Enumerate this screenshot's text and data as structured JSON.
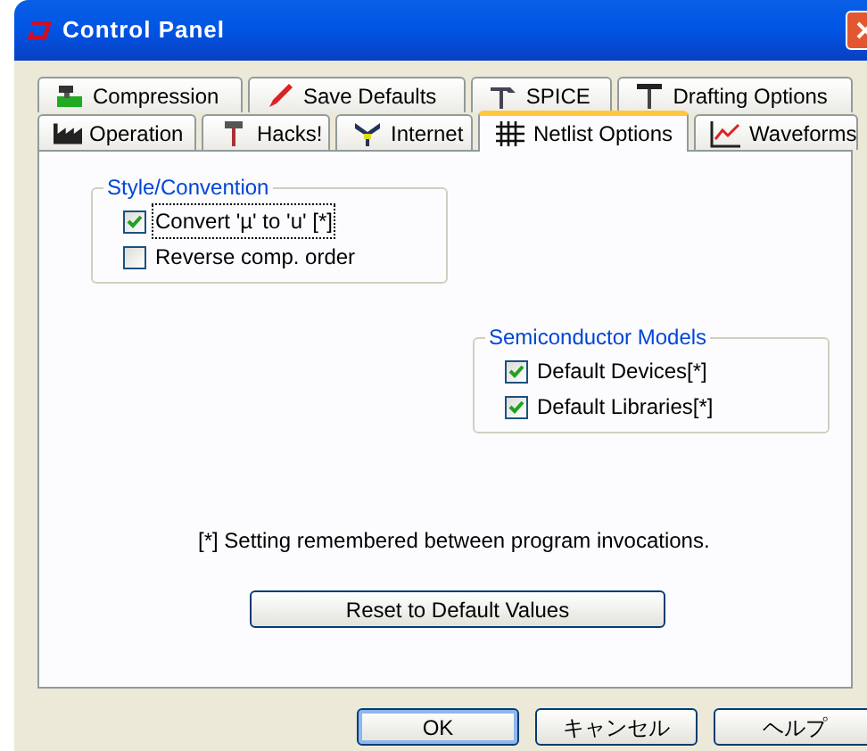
{
  "window": {
    "title": "Control Panel"
  },
  "tab_rows": [
    [
      {
        "label": "Compression",
        "selected": false
      },
      {
        "label": "Save Defaults",
        "selected": false
      },
      {
        "label": "SPICE",
        "selected": false
      },
      {
        "label": "Drafting Options",
        "selected": false
      }
    ],
    [
      {
        "label": "Operation",
        "selected": false
      },
      {
        "label": "Hacks!",
        "selected": false
      },
      {
        "label": "Internet",
        "selected": false
      },
      {
        "label": "Netlist Options",
        "selected": true
      },
      {
        "label": "Waveforms",
        "selected": false
      }
    ]
  ],
  "groups": [
    {
      "title": "Style/Convention",
      "options": [
        {
          "label": "Convert 'µ' to 'u' [*]",
          "checked": true,
          "focused": true
        },
        {
          "label": "Reverse comp. order",
          "checked": false,
          "focused": false
        }
      ]
    },
    {
      "title": "Semiconductor Models",
      "options": [
        {
          "label": "Default Devices[*]",
          "checked": true,
          "focused": false
        },
        {
          "label": "Default Libraries[*]",
          "checked": true,
          "focused": false
        }
      ]
    }
  ],
  "note": "[*] Setting remembered between program invocations.",
  "reset_button": "Reset to Default Values",
  "buttons": [
    {
      "label": "OK",
      "default": true
    },
    {
      "label": "キャンセル",
      "default": false
    },
    {
      "label": "ヘルプ",
      "default": false
    }
  ]
}
